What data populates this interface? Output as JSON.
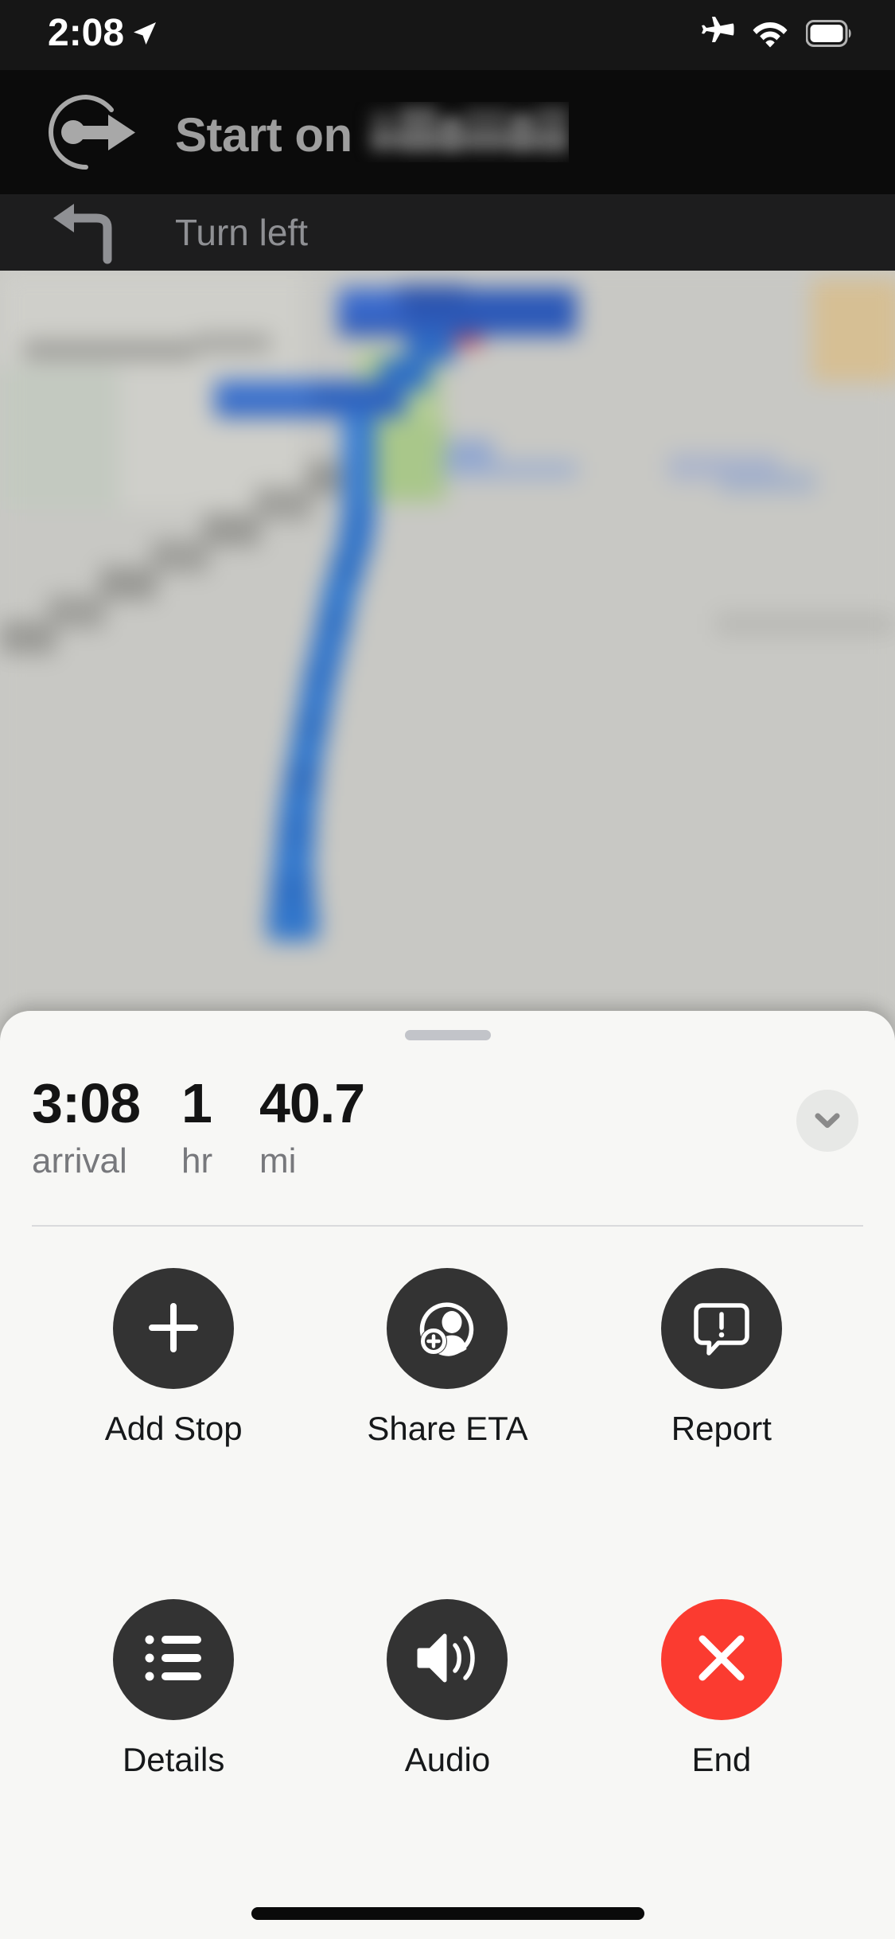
{
  "status_bar": {
    "time": "2:08",
    "location_arrow_icon": "location-arrow-icon",
    "airplane_icon": "airplane-mode-icon",
    "wifi_icon": "wifi-icon",
    "battery_icon": "battery-full-icon",
    "background_color": "#161616"
  },
  "navigation": {
    "primary": {
      "maneuver_icon": "start-navigation-icon",
      "instruction_prefix": "Start on",
      "street_name": "",
      "street_name_redacted": true,
      "text_color": "#9e9e9e",
      "background_color": "#0b0b0b"
    },
    "secondary": {
      "maneuver_icon": "turn-left-icon",
      "instruction": "Turn left",
      "text_color": "#8f9094",
      "background_color": "#1d1d1e"
    }
  },
  "map": {
    "route_color": "#2272c4",
    "road_color": "#9b9b97",
    "land_color": "#c9c9c5",
    "park_color": "#a8c48a",
    "water_color": "#2b5fbe",
    "redacted": true
  },
  "sheet": {
    "drag_handle_color": "#c2c4c9",
    "background_color": "#f7f7f5",
    "eta": [
      {
        "name": "arrival",
        "value": "3:08",
        "unit": "arrival"
      },
      {
        "name": "duration",
        "value": "1",
        "unit": "hr"
      },
      {
        "name": "distance",
        "value": "40.7",
        "unit": "mi"
      }
    ],
    "collapse_button": {
      "icon": "chevron-down-icon",
      "background_color": "#e7e8e6",
      "glyph_color": "#8a8a8a"
    },
    "actions": [
      {
        "name": "add-stop",
        "label": "Add Stop",
        "icon": "plus-icon",
        "style": "dark"
      },
      {
        "name": "share-eta",
        "label": "Share ETA",
        "icon": "person-badge-plus-icon",
        "style": "dark"
      },
      {
        "name": "report",
        "label": "Report",
        "icon": "speech-bubble-exclamation-icon",
        "style": "dark"
      },
      {
        "name": "details",
        "label": "Details",
        "icon": "bulleted-list-icon",
        "style": "dark"
      },
      {
        "name": "audio",
        "label": "Audio",
        "icon": "speaker-waves-icon",
        "style": "dark"
      },
      {
        "name": "end",
        "label": "End",
        "icon": "x-mark-icon",
        "style": "danger"
      }
    ],
    "action_bubble_color": "#333333",
    "danger_color": "#fb3b30"
  },
  "home_indicator": {
    "color": "#0a0a0a"
  }
}
